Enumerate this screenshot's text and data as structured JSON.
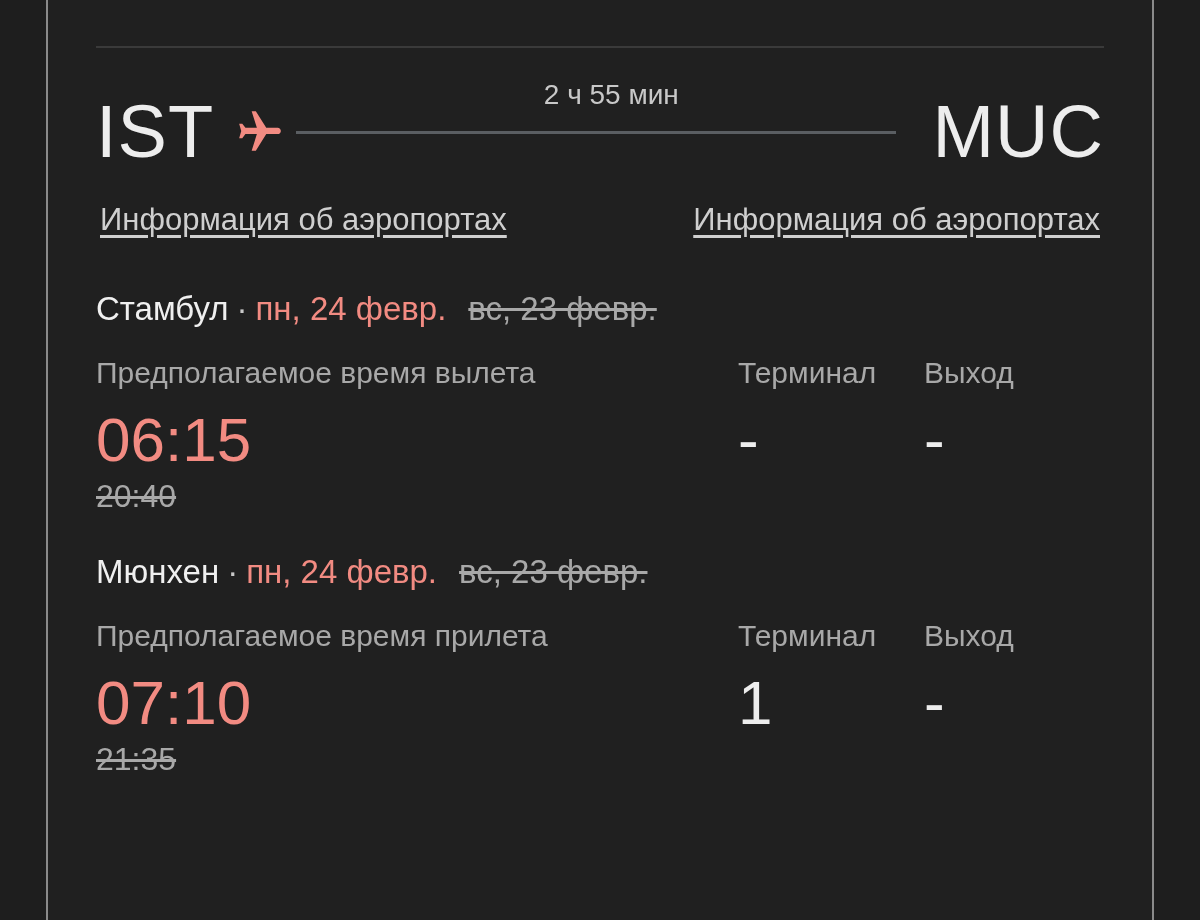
{
  "route": {
    "duration": "2 ч 55 мин",
    "origin": {
      "code": "IST",
      "link": "Информация об аэропортах"
    },
    "destination": {
      "code": "MUC",
      "link": "Информация об аэропортах"
    }
  },
  "legs": [
    {
      "city": "Стамбул",
      "separator": "·",
      "new_date": "пн, 24 февр.",
      "old_date": "вс, 23 февр.",
      "time_label": "Предполагаемое время вылета",
      "new_time": "06:15",
      "old_time": "20:40",
      "terminal_label": "Терминал",
      "terminal": "-",
      "gate_label": "Выход",
      "gate": "-"
    },
    {
      "city": "Мюнхен",
      "separator": "·",
      "new_date": "пн, 24 февр.",
      "old_date": "вс, 23 февр.",
      "time_label": "Предполагаемое время прилета",
      "new_time": "07:10",
      "old_time": "21:35",
      "terminal_label": "Терминал",
      "terminal": "1",
      "gate_label": "Выход",
      "gate": "-"
    }
  ]
}
